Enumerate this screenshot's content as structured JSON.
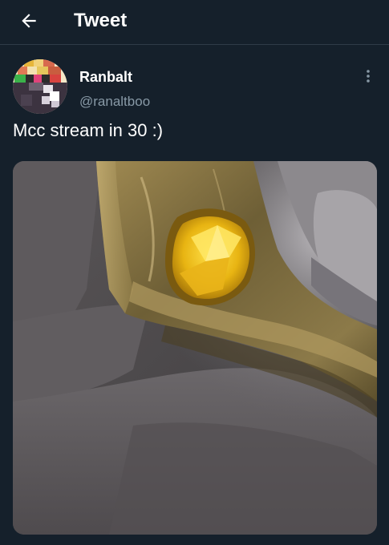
{
  "header": {
    "title": "Tweet",
    "back_icon": "arrow-left-icon"
  },
  "tweet": {
    "author": {
      "display_name": "Ranbalt",
      "handle": "@ranaltboo",
      "avatar_icon": "pixel-avatar"
    },
    "more_icon": "more-vertical-icon",
    "text": "Mcc stream in 30 :)",
    "media": {
      "kind": "photo"
    }
  },
  "colors": {
    "background": "#15202b",
    "secondary_text": "#8899a6",
    "divider": "#2f3b47"
  }
}
